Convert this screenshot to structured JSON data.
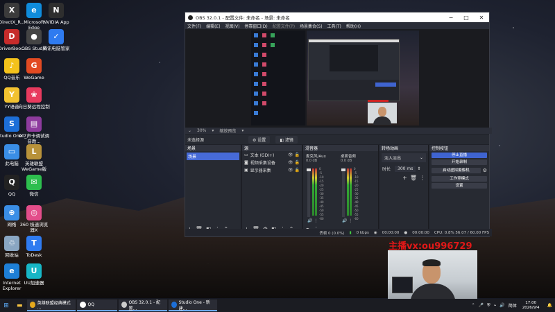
{
  "desktop": {
    "icons": [
      {
        "label": "DirectX_R...",
        "icon": "directx-icon",
        "color": "#3b3b3b",
        "glyph": "X"
      },
      {
        "label": "Microsoft Edge",
        "icon": "edge-icon",
        "color": "#0f8cdc",
        "glyph": "e"
      },
      {
        "label": "NVIDIA App",
        "icon": "nvidia-icon",
        "color": "#2e2e2e",
        "glyph": "N"
      },
      {
        "label": "DriverBoo...",
        "icon": "driverbooster-icon",
        "color": "#c62b2b",
        "glyph": "D"
      },
      {
        "label": "OBS Studio",
        "icon": "obs-icon",
        "color": "#444",
        "glyph": "●"
      },
      {
        "label": "腾讯电脑管家",
        "icon": "tencent-pc-manager-icon",
        "color": "#2f7bf0",
        "glyph": "✓"
      },
      {
        "label": "QQ音乐",
        "icon": "qq-music-icon",
        "color": "#f4c21b",
        "glyph": "♪"
      },
      {
        "label": "WeGame",
        "icon": "wegame-icon",
        "color": "#e24a22",
        "glyph": "G"
      },
      {
        "label": "YY语音",
        "icon": "yy-icon",
        "color": "#f2c230",
        "glyph": "Y"
      },
      {
        "label": "向日葵远程控制",
        "icon": "sunflower-icon",
        "color": "#e83a5e",
        "glyph": "❀"
      },
      {
        "label": "Studio One 7",
        "icon": "studio-one-icon",
        "color": "#1d6fd8",
        "glyph": "S"
      },
      {
        "label": "00_声卡调试调音教...",
        "icon": "winrar-icon",
        "color": "#8e3b9e",
        "glyph": "▤"
      },
      {
        "label": "此电脑",
        "icon": "this-pc-icon",
        "color": "#3a8ee6",
        "glyph": "▭"
      },
      {
        "label": "英雄联盟WeGame版",
        "icon": "league-icon",
        "color": "#b8923a",
        "glyph": "L"
      },
      {
        "label": "QQ",
        "icon": "qq-icon",
        "color": "#222",
        "glyph": "Q"
      },
      {
        "label": "微信",
        "icon": "wechat-icon",
        "color": "#2dbe4e",
        "glyph": "✉"
      },
      {
        "label": "网络",
        "icon": "network-icon",
        "color": "#3a8ee6",
        "glyph": "⊕"
      },
      {
        "label": "360 极速浏览器X",
        "icon": "360-browser-icon",
        "color": "#e34d8a",
        "glyph": "◎"
      },
      {
        "label": "回收站",
        "icon": "recycle-bin-icon",
        "color": "#8aa6c2",
        "glyph": "♲"
      },
      {
        "label": "ToDesk",
        "icon": "todesk-icon",
        "color": "#2f7bf0",
        "glyph": "T"
      },
      {
        "label": "Internet Explorer",
        "icon": "ie-icon",
        "color": "#1e7fd6",
        "glyph": "e"
      },
      {
        "label": "UU加速器",
        "icon": "uu-icon",
        "color": "#17b6c5",
        "glyph": "U"
      }
    ]
  },
  "obs": {
    "title": "OBS 32.0.1 - 配置文件: 未命名 - 场景: 未命名",
    "menu": [
      {
        "label": "文件(F)",
        "dim": false
      },
      {
        "label": "编辑(E)",
        "dim": false
      },
      {
        "label": "视图(V)",
        "dim": false
      },
      {
        "label": "停靠窗口(D)",
        "dim": false
      },
      {
        "label": "配置文件(P)",
        "dim": true
      },
      {
        "label": "场景集合(S)",
        "dim": false
      },
      {
        "label": "工具(T)",
        "dim": false
      },
      {
        "label": "帮助(H)",
        "dim": false
      }
    ],
    "viewbar": {
      "zoom": "30%",
      "zoom_arrow": "▾",
      "mode": "缩放预览",
      "mode_arrow": "▾"
    },
    "context": {
      "no_selection": "未选择源",
      "properties": "设置",
      "filters": "滤镜"
    },
    "docks": {
      "scenes": {
        "title": "场景",
        "items": [
          "场景"
        ]
      },
      "sources": {
        "title": "源",
        "items": [
          {
            "icon": "monitor-icon",
            "glyph": "▭",
            "label": "文本 (GDI+)"
          },
          {
            "icon": "camera-icon",
            "glyph": "◙",
            "label": "视频采集设备"
          },
          {
            "icon": "display-icon",
            "glyph": "▣",
            "label": "显示器采集"
          }
        ]
      },
      "mixer": {
        "title": "混音器",
        "channels": [
          {
            "name": "麦克风/Aux",
            "db": "0.0 dB"
          },
          {
            "name": "桌面音频",
            "db": "0.0 dB"
          }
        ],
        "scale": [
          "0",
          "-5",
          "-10",
          "-15",
          "-20",
          "-25",
          "-30",
          "-35",
          "-40",
          "-45",
          "-50",
          "-55",
          "-60"
        ]
      },
      "transitions": {
        "title": "转场动画",
        "type": "淡入淡出",
        "duration_label": "时长",
        "duration": "300 ms"
      },
      "controls": {
        "title": "控制按钮",
        "buttons": [
          "停止直播",
          "开始录制",
          "启动虚拟摄像机",
          "工作室模式",
          "设置"
        ]
      }
    },
    "status": {
      "dropped": "丢帧 0 (0.0%)",
      "kbps": "0 kbps",
      "stream_time": "00:00:00",
      "rec_time": "00:00:00",
      "cpu": "CPU: 0.8%  56.07 / 60.00 FPS"
    }
  },
  "overlay": {
    "watermark": "主播vx:ou996729"
  },
  "taskbar": {
    "items": [
      {
        "label": "英雄联盟经典模式 ...",
        "icon": "chrome-icon",
        "color": "#e6a91c"
      },
      {
        "label": "QQ",
        "icon": "qq-icon",
        "color": "#ffffff"
      },
      {
        "label": "OBS 32.0.1 - 配置...",
        "icon": "obs-icon",
        "color": "#cccccc"
      },
      {
        "label": "Studio One - 新建...",
        "icon": "studio-one-icon",
        "color": "#1d6fd8"
      }
    ],
    "lang": "简体",
    "time": "17:00",
    "date": "2026/9/4"
  }
}
